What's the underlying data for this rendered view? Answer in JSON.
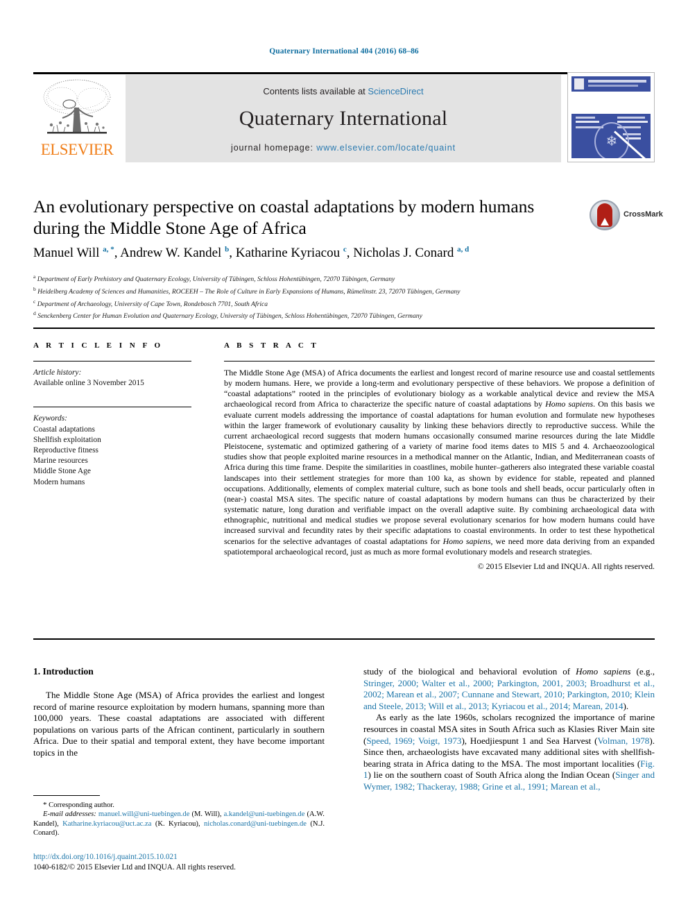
{
  "running_head": "Quaternary International 404 (2016) 68–86",
  "header": {
    "contents_label": "Contents lists available at",
    "sciencedirect": "ScienceDirect",
    "journal_title": "Quaternary International",
    "homepage_label": "journal homepage:",
    "homepage_url": "www.elsevier.com/locate/quaint",
    "publisher": "ELSEVIER",
    "cover_alt": "Quaternary International journal cover"
  },
  "article": {
    "title": "An evolutionary perspective on coastal adaptations by modern humans during the Middle Stone Age of Africa",
    "crossmark_label": "CrossMark",
    "authors_html": "Manuel Will <sup>a, *</sup>, Andrew W. Kandel <sup>b</sup>, Katharine Kyriacou <sup>c</sup>, Nicholas J. Conard <sup>a, d</sup>",
    "affiliations": [
      "Department of Early Prehistory and Quaternary Ecology, University of Tübingen, Schloss Hohentübingen, 72070 Tübingen, Germany",
      "Heidelberg Academy of Sciences and Humanities, ROCEEH – The Role of Culture in Early Expansions of Humans, Rümelinstr. 23, 72070 Tübingen, Germany",
      "Department of Archaeology, University of Cape Town, Rondebosch 7701, South Africa",
      "Senckenberg Center for Human Evolution and Quaternary Ecology, University of Tübingen, Schloss Hohentübingen, 72070 Tübingen, Germany"
    ],
    "affiliation_marks": [
      "a",
      "b",
      "c",
      "d"
    ]
  },
  "article_info": {
    "heading": "A R T I C L E   I N F O",
    "history_label": "Article history:",
    "history_value": "Available online 3 November 2015",
    "keywords_label": "Keywords:",
    "keywords": [
      "Coastal adaptations",
      "Shellfish exploitation",
      "Reproductive fitness",
      "Marine resources",
      "Middle Stone Age",
      "Modern humans"
    ]
  },
  "abstract": {
    "heading": "A B S T R A C T",
    "text": "The Middle Stone Age (MSA) of Africa documents the earliest and longest record of marine resource use and coastal settlements by modern humans. Here, we provide a long-term and evolutionary perspective of these behaviors. We propose a definition of “coastal adaptations” rooted in the principles of evolutionary biology as a workable analytical device and review the MSA archaeological record from Africa to characterize the specific nature of coastal adaptations by Homo sapiens. On this basis we evaluate current models addressing the importance of coastal adaptations for human evolution and formulate new hypotheses within the larger framework of evolutionary causality by linking these behaviors directly to reproductive success. While the current archaeological record suggests that modern humans occasionally consumed marine resources during the late Middle Pleistocene, systematic and optimized gathering of a variety of marine food items dates to MIS 5 and 4. Archaeozoological studies show that people exploited marine resources in a methodical manner on the Atlantic, Indian, and Mediterranean coasts of Africa during this time frame. Despite the similarities in coastlines, mobile hunter–gatherers also integrated these variable coastal landscapes into their settlement strategies for more than 100 ka, as shown by evidence for stable, repeated and planned occupations. Additionally, elements of complex material culture, such as bone tools and shell beads, occur particularly often in (near-) coastal MSA sites. The specific nature of coastal adaptations by modern humans can thus be characterized by their systematic nature, long duration and verifiable impact on the overall adaptive suite. By combining archaeological data with ethnographic, nutritional and medical studies we propose several evolutionary scenarios for how modern humans could have increased survival and fecundity rates by their specific adaptations to coastal environments. In order to test these hypothetical scenarios for the selective advantages of coastal adaptations for Homo sapiens, we need more data deriving from an expanded spatiotemporal archaeological record, just as much as more formal evolutionary models and research strategies.",
    "italic_terms": [
      "Homo sapiens"
    ],
    "copyright": "© 2015 Elsevier Ltd and INQUA. All rights reserved."
  },
  "body": {
    "section_heading": "1. Introduction",
    "para1_left": "The Middle Stone Age (MSA) of Africa provides the earliest and longest record of marine resource exploitation by modern humans, spanning more than 100,000 years. These coastal adaptations are associated with different populations on various parts of the African continent, particularly in southern Africa. Due to their spatial and temporal extent, they have become important topics in the",
    "para1_right_plain": "study of the biological and behavioral evolution of ",
    "para1_right_italic": "Homo sapiens",
    "para1_right_tail": " (e.g., ",
    "para1_right_cites": "Stringer, 2000; Walter et al., 2000; Parkington, 2001, 2003; Broadhurst et al., 2002; Marean et al., 2007; Cunnane and Stewart, 2010; Parkington, 2010; Klein and Steele, 2013; Will et al., 2013; Kyriacou et al., 2014; Marean, 2014",
    "para1_right_close": ").",
    "para2_seg1": "As early as the late 1960s, scholars recognized the importance of marine resources in coastal MSA sites in South Africa such as Klasies River Main site (",
    "para2_cite1": "Speed, 1969; Voigt, 1973",
    "para2_seg2": "), Hoedjiespunt 1 and Sea Harvest (",
    "para2_cite2": "Volman, 1978",
    "para2_seg3": "). Since then, archaeologists have excavated many additional sites with shellfish-bearing strata in Africa dating to the MSA. The most important localities (",
    "para2_cite3": "Fig. 1",
    "para2_seg4": ") lie on the southern coast of South Africa along the Indian Ocean (",
    "para2_cite4": "Singer and Wymer, 1982; Thackeray, 1988; Grine et al., 1991; Marean et al.,"
  },
  "footnote": {
    "corresponding_marker": "*",
    "corresponding_label": "Corresponding author.",
    "email_label": "E-mail addresses:",
    "emails": [
      {
        "address": "manuel.will@uni-tuebingen.de",
        "person": "(M. Will)"
      },
      {
        "address": "a.kandel@uni-tuebingen.de",
        "person": "(A.W. Kandel)"
      },
      {
        "address": "Katharine.kyriacou@uct.ac.za",
        "person": "(K. Kyriacou)"
      },
      {
        "address": "nicholas.conard@uni-tuebingen.de",
        "person": "(N.J. Conard)"
      }
    ]
  },
  "doi_block": {
    "doi_url": "http://dx.doi.org/10.1016/j.quaint.2015.10.021",
    "issn_line": "1040-6182/© 2015 Elsevier Ltd and INQUA. All rights reserved."
  },
  "colors": {
    "link_blue": "#1a74a8",
    "header_blue": "#0f6ea0",
    "sciencedirect_blue": "#2a7ab0",
    "elsevier_orange": "#f07f1a",
    "banner_gray": "#e3e3e3",
    "crossmark_red": "#b01f16",
    "cover_blue": "#3a4fa0"
  }
}
